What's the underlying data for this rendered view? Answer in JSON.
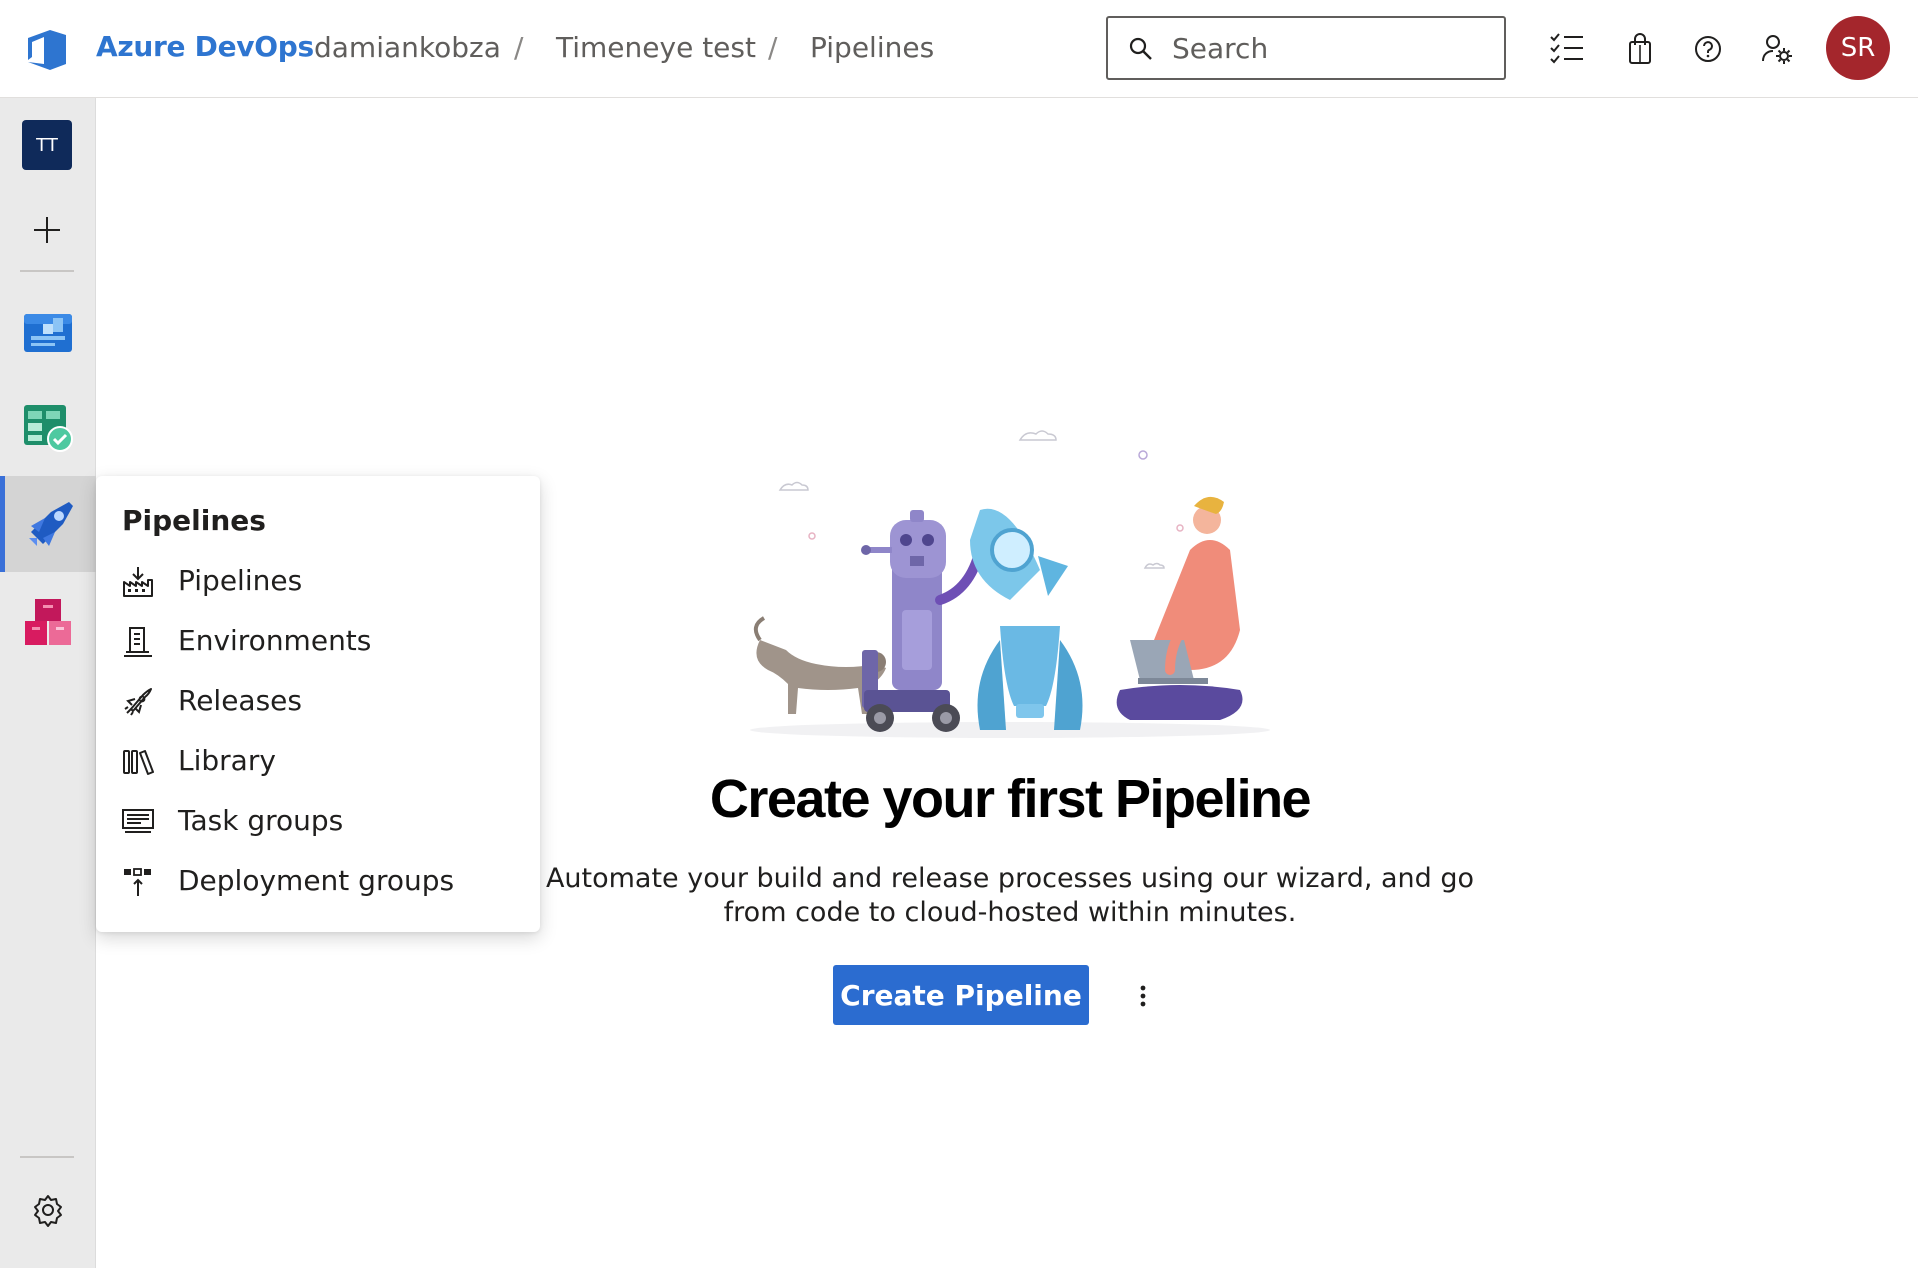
{
  "header": {
    "brand": "Azure DevOps",
    "breadcrumb": [
      "damiankobza",
      "Timeneye test",
      "Pipelines"
    ],
    "separator": "/",
    "search_placeholder": "Search",
    "icons": [
      "task-list-icon",
      "shopping-bag-icon",
      "help-icon",
      "user-settings-icon"
    ],
    "avatar_initials": "SR",
    "avatar_color": "#a4262c"
  },
  "rail": {
    "project_initials": "TT",
    "items": [
      "boards",
      "test-plans",
      "pipelines",
      "artifacts"
    ],
    "active_item": "pipelines"
  },
  "flyout": {
    "title": "Pipelines",
    "items": [
      {
        "label": "Pipelines",
        "icon": "pipelines-icon"
      },
      {
        "label": "Environments",
        "icon": "environments-icon"
      },
      {
        "label": "Releases",
        "icon": "releases-icon"
      },
      {
        "label": "Library",
        "icon": "library-icon"
      },
      {
        "label": "Task groups",
        "icon": "task-groups-icon"
      },
      {
        "label": "Deployment groups",
        "icon": "deployment-groups-icon"
      }
    ]
  },
  "main": {
    "headline": "Create your first Pipeline",
    "description": "Automate your build and release processes using our wizard, and go from code to cloud-hosted within minutes.",
    "create_button": "Create Pipeline",
    "accent_color": "#2b6cd0"
  }
}
